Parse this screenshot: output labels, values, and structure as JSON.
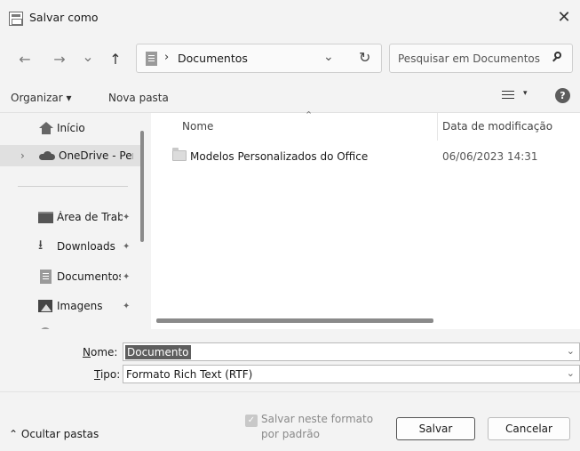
{
  "window": {
    "title": "Salvar como",
    "close_glyph": "✕",
    "icon": "save-dialog-icon"
  },
  "nav": {
    "back_glyph": "←",
    "forward_glyph": "→",
    "recent_glyph": "⌄",
    "up_glyph": "↑",
    "address": {
      "separator": "›",
      "path": "Documentos",
      "dropdown_glyph": "⌄",
      "refresh_glyph": "↻"
    },
    "search": {
      "placeholder": "Pesquisar em Documentos"
    }
  },
  "toolbar": {
    "organize_label": "Organizar ▾",
    "new_folder_label": "Nova pasta",
    "view_arrow": "▾",
    "help_glyph": "?"
  },
  "sidebar": {
    "items": [
      {
        "label": "Início",
        "icon": "home-icon",
        "pinned": false
      },
      {
        "label": "OneDrive - Perso",
        "icon": "cloud-icon",
        "expander": "›",
        "pinned": false
      },
      {
        "label": "Área de Traba",
        "icon": "desktop-icon",
        "pinned": true
      },
      {
        "label": "Downloads",
        "icon": "download-icon",
        "pinned": true
      },
      {
        "label": "Documentos",
        "icon": "documents-icon",
        "pinned": true
      },
      {
        "label": "Imagens",
        "icon": "pictures-icon",
        "pinned": true
      }
    ],
    "pin_glyph": "📌"
  },
  "files": {
    "columns": {
      "name": "Nome",
      "modified": "Data de modificação"
    },
    "sort_glyph": "⌃",
    "rows": [
      {
        "name": "Modelos Personalizados do Office",
        "modified": "06/06/2023 14:31"
      }
    ]
  },
  "form": {
    "name_label_prefix": "",
    "name_label_accel": "N",
    "name_label_rest": "ome:",
    "name_value": "Documento",
    "type_label_accel": "T",
    "type_label_rest": "ipo:",
    "type_value": "Formato Rich Text (RTF)",
    "dropdown_glyph": "⌄"
  },
  "footer": {
    "hide_folders_label": "⌃ Ocultar pastas",
    "save_default_checked": true,
    "save_default_label": "Salvar neste formato por padrão",
    "save_button_label": "Salvar",
    "cancel_button_label": "Cancelar"
  },
  "colors": {
    "selection": "#5e5e5e",
    "background": "#f3f3f3",
    "content": "#ffffff"
  }
}
